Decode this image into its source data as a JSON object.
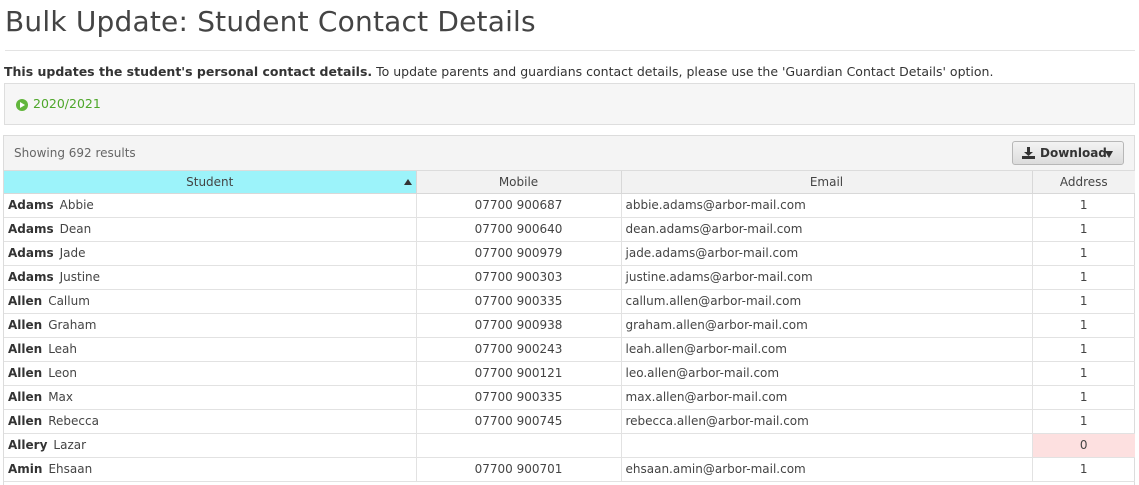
{
  "page": {
    "title": "Bulk Update: Student Contact Details",
    "intro_bold": "This updates the student's personal contact details.",
    "intro_rest": " To update parents and guardians contact details, please use the 'Guardian Contact Details' option.",
    "year_link": "2020/2021"
  },
  "table": {
    "results_text": "Showing 692 results",
    "download_label": "Download",
    "columns": [
      "Student",
      "Mobile",
      "Email",
      "Address"
    ],
    "rows": [
      {
        "last": "Adams",
        "first": "Abbie",
        "mobile": "07700 900687",
        "email": "abbie.adams@arbor-mail.com",
        "address": "1"
      },
      {
        "last": "Adams",
        "first": "Dean",
        "mobile": "07700 900640",
        "email": "dean.adams@arbor-mail.com",
        "address": "1"
      },
      {
        "last": "Adams",
        "first": "Jade",
        "mobile": "07700 900979",
        "email": "jade.adams@arbor-mail.com",
        "address": "1"
      },
      {
        "last": "Adams",
        "first": "Justine",
        "mobile": "07700 900303",
        "email": "justine.adams@arbor-mail.com",
        "address": "1"
      },
      {
        "last": "Allen",
        "first": "Callum",
        "mobile": "07700 900335",
        "email": "callum.allen@arbor-mail.com",
        "address": "1"
      },
      {
        "last": "Allen",
        "first": "Graham",
        "mobile": "07700 900938",
        "email": "graham.allen@arbor-mail.com",
        "address": "1"
      },
      {
        "last": "Allen",
        "first": "Leah",
        "mobile": "07700 900243",
        "email": "leah.allen@arbor-mail.com",
        "address": "1"
      },
      {
        "last": "Allen",
        "first": "Leon",
        "mobile": "07700 900121",
        "email": "leo.allen@arbor-mail.com",
        "address": "1"
      },
      {
        "last": "Allen",
        "first": "Max",
        "mobile": "07700 900335",
        "email": "max.allen@arbor-mail.com",
        "address": "1"
      },
      {
        "last": "Allen",
        "first": "Rebecca",
        "mobile": "07700 900745",
        "email": "rebecca.allen@arbor-mail.com",
        "address": "1"
      },
      {
        "last": "Allery",
        "first": "Lazar",
        "mobile": "",
        "email": "",
        "address": "0"
      },
      {
        "last": "Amin",
        "first": "Ehsaan",
        "mobile": "07700 900701",
        "email": "ehsaan.amin@arbor-mail.com",
        "address": "1"
      }
    ]
  },
  "colors": {
    "sorted_header": "#9cf3fa",
    "link_green": "#4ea72a",
    "missing_bg": "#fde0e0"
  },
  "icons": [
    "play-circle-icon",
    "download-icon",
    "caret-down-icon",
    "sort-ascending-icon"
  ]
}
